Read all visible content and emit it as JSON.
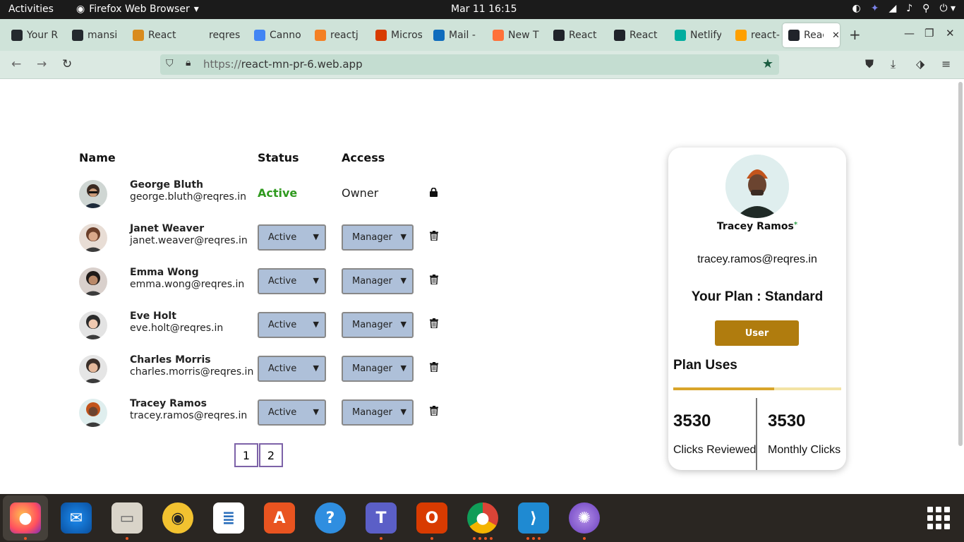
{
  "topbar": {
    "activities": "Activities",
    "app_name": "Firefox Web Browser",
    "clock": "Mar 11  16:15"
  },
  "browser": {
    "tabs": [
      {
        "label": "Your R",
        "icon": "github-icon",
        "color": "#24292e"
      },
      {
        "label": "mansi",
        "icon": "github-icon",
        "color": "#24292e"
      },
      {
        "label": "React",
        "icon": "medium-icon",
        "color": "#d98b1e"
      },
      {
        "label": "reqres.in/",
        "icon": "blank-icon",
        "color": "#cfe3d9"
      },
      {
        "label": "Canno",
        "icon": "google-icon",
        "color": "#4285f4"
      },
      {
        "label": "reactj",
        "icon": "stackoverflow-icon",
        "color": "#f48024"
      },
      {
        "label": "Micros",
        "icon": "office-icon",
        "color": "#d83b01"
      },
      {
        "label": "Mail -",
        "icon": "outlook-icon",
        "color": "#0f6cbd"
      },
      {
        "label": "New T",
        "icon": "firefox-icon",
        "color": "#ff7139"
      },
      {
        "label": "React",
        "icon": "react-icon",
        "color": "#20232a"
      },
      {
        "label": "React",
        "icon": "react-icon",
        "color": "#20232a"
      },
      {
        "label": "Netlify",
        "icon": "netlify-icon",
        "color": "#00ad9f"
      },
      {
        "label": "react-",
        "icon": "firebase-icon",
        "color": "#ffa000"
      },
      {
        "label": "Reac",
        "icon": "react-icon",
        "color": "#20232a"
      }
    ],
    "url_prefix": "https://",
    "url_host": "react-mn-pr-6.web.app"
  },
  "table": {
    "headers": {
      "name": "Name",
      "status": "Status",
      "access": "Access"
    },
    "owner": {
      "name": "George Bluth",
      "email": "george.bluth@reqres.in",
      "status": "Active",
      "access": "Owner",
      "icon": "lock-icon"
    },
    "rows": [
      {
        "name": "Janet Weaver",
        "email": "janet.weaver@reqres.in",
        "status": "Active",
        "access": "Manager"
      },
      {
        "name": "Emma Wong",
        "email": "emma.wong@reqres.in",
        "status": "Active",
        "access": "Manager"
      },
      {
        "name": "Eve Holt",
        "email": "eve.holt@reqres.in",
        "status": "Active",
        "access": "Manager"
      },
      {
        "name": "Charles Morris",
        "email": "charles.morris@reqres.in",
        "status": "Active",
        "access": "Manager"
      },
      {
        "name": "Tracey Ramos",
        "email": "tracey.ramos@reqres.in",
        "status": "Active",
        "access": "Manager"
      }
    ],
    "row_icon": "trash-icon",
    "pages": [
      "1",
      "2"
    ]
  },
  "profile": {
    "name": "Tracey Ramos",
    "online_marker": "*",
    "email": "tracey.ramos@reqres.in",
    "plan": "Your Plan : Standard",
    "role_button": "User",
    "uses_title": "Plan Uses",
    "usage_fraction": 0.6,
    "clicks_reviewed": "3530",
    "clicks_reviewed_label": "Clicks Reviewed",
    "monthly_clicks": "3530",
    "monthly_clicks_label": "Monthly Clicks",
    "button_color": "#b07c0e",
    "bar_color": "#d9a52a"
  },
  "dock": [
    "firefox-icon",
    "thunderbird-icon",
    "files-icon",
    "rhythmbox-icon",
    "writer-icon",
    "software-icon",
    "help-icon",
    "teams-icon",
    "office-icon",
    "chrome-icon",
    "vscode-icon",
    "network-icon"
  ]
}
